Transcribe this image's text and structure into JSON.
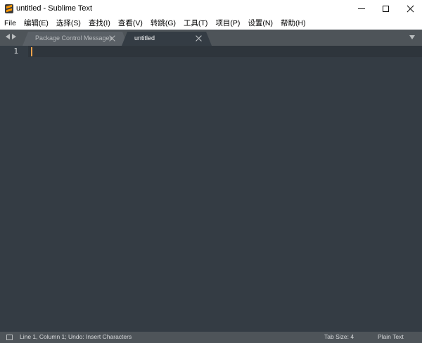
{
  "window": {
    "title": "untitled - Sublime Text"
  },
  "menu": {
    "items": [
      {
        "label": "File"
      },
      {
        "label": "编辑(E)"
      },
      {
        "label": "选择(S)"
      },
      {
        "label": "查找(I)"
      },
      {
        "label": "查看(V)"
      },
      {
        "label": "转跳(G)"
      },
      {
        "label": "工具(T)"
      },
      {
        "label": "项目(P)"
      },
      {
        "label": "设置(N)"
      },
      {
        "label": "帮助(H)"
      }
    ]
  },
  "tabs": [
    {
      "label": "Package Control Messages",
      "active": false
    },
    {
      "label": "untitled",
      "active": true
    }
  ],
  "editor": {
    "line_numbers": [
      "1"
    ],
    "content": ""
  },
  "status": {
    "position": "Line 1, Column 1; Undo: Insert Characters",
    "tab_size": "Tab Size: 4",
    "syntax": "Plain Text"
  },
  "colors": {
    "editor_bg": "#343c44",
    "tabbar_bg": "#4e5459",
    "cursor": "#f6a34b",
    "app_icon": "#ff9800"
  },
  "icons": [
    "sublime-text-icon",
    "minimize-icon",
    "maximize-icon",
    "close-icon",
    "arrow-left-icon",
    "arrow-right-icon",
    "tab-close-icon",
    "chevron-down-icon",
    "panel-toggle-icon"
  ]
}
